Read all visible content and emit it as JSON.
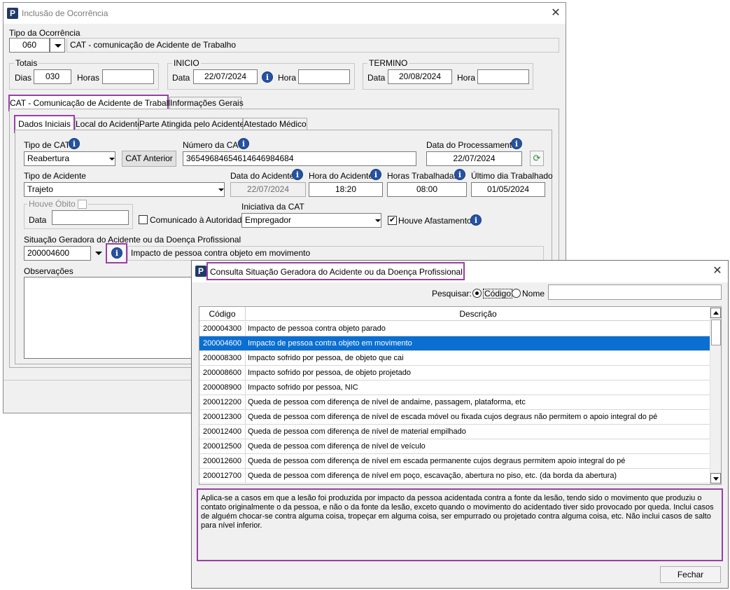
{
  "main_window": {
    "title": "Inclusão de Ocorrência",
    "tipo_ocorrencia": {
      "label": "Tipo da Ocorrência",
      "code": "060",
      "description": "CAT - comunicação de Acidente de Trabalho"
    },
    "totais": {
      "title": "Totais",
      "dias_label": "Dias",
      "dias_value": "030",
      "horas_label": "Horas",
      "horas_value": ""
    },
    "inicio": {
      "title": "INICIO",
      "data_label": "Data",
      "data_value": "22/07/2024",
      "hora_label": "Hora",
      "hora_value": ""
    },
    "termino": {
      "title": "TERMINO",
      "data_label": "Data",
      "data_value": "20/08/2024",
      "hora_label": "Hora",
      "hora_value": ""
    },
    "outer_tabs": [
      "CAT - Comunicação de Acidente de Trabalho",
      "Informações Gerais"
    ],
    "inner_tabs": [
      "Dados Iniciais",
      "Local do Acidente",
      "Parte Atingida pelo Acidente",
      "Atestado Médico"
    ],
    "form": {
      "tipo_cat_label": "Tipo de CAT",
      "tipo_cat_value": "Reabertura",
      "cat_anterior_label": "CAT Anterior",
      "numero_cat_label": "Número da CAT",
      "numero_cat_value": "36549684654614646984684",
      "data_processamento_label": "Data do Processamento",
      "data_processamento_value": "22/07/2024",
      "tipo_acidente_label": "Tipo de Acidente",
      "tipo_acidente_value": "Trajeto",
      "data_acidente_label": "Data do Acidente",
      "data_acidente_value": "22/07/2024",
      "hora_acidente_label": "Hora do Acidente",
      "hora_acidente_value": "18:20",
      "horas_trabalhadas_label": "Horas Trabalhadas",
      "horas_trabalhadas_value": "08:00",
      "ultimo_dia_label": "Último dia Trabalhado",
      "ultimo_dia_value": "01/05/2024",
      "houve_obito_label": "Houve Óbito",
      "obito_data_label": "Data",
      "obito_data_value": "",
      "comunicado_label": "Comunicado à Autoridade",
      "iniciativa_label": "Iniciativa da CAT",
      "iniciativa_value": "Empregador",
      "houve_afastamento_label": "Houve Afastamento",
      "houve_afastamento_checked": true,
      "situacao_label": "Situação Geradora do Acidente ou da Doença Profissional",
      "situacao_code": "200004600",
      "situacao_desc": "Impacto de pessoa contra objeto em movimento",
      "observacoes_label": "Observações"
    }
  },
  "dialog": {
    "title": "Consulta Situação Geradora do Acidente ou da Doença Profissional",
    "search_label": "Pesquisar:",
    "radio_codigo": "Código",
    "radio_nome": "Nome",
    "search_value": "",
    "columns": [
      "Código",
      "Descrição"
    ],
    "rows": [
      {
        "code": "200004300",
        "desc": "Impacto de pessoa contra objeto parado"
      },
      {
        "code": "200004600",
        "desc": "Impacto de pessoa contra objeto em movimento",
        "selected": true
      },
      {
        "code": "200008300",
        "desc": "Impacto sofrido por pessoa, de objeto que cai"
      },
      {
        "code": "200008600",
        "desc": "Impacto sofrido por pessoa, de objeto projetado"
      },
      {
        "code": "200008900",
        "desc": "Impacto sofrido por pessoa, NIC"
      },
      {
        "code": "200012200",
        "desc": "Queda de pessoa com diferença de nível de andaime, passagem, plataforma, etc"
      },
      {
        "code": "200012300",
        "desc": "Queda de pessoa com diferença de nível de escada móvel ou fixada cujos degraus não permitem o apoio integral do pé"
      },
      {
        "code": "200012400",
        "desc": "Queda de pessoa com diferença de nível de material empilhado"
      },
      {
        "code": "200012500",
        "desc": "Queda de pessoa com diferença de nível de veículo"
      },
      {
        "code": "200012600",
        "desc": "Queda de pessoa com diferença de nível em escada permanente cujos degraus permitem apoio integral do pé"
      },
      {
        "code": "200012700",
        "desc": "Queda de pessoa com diferença de nível em poço, escavação, abertura no piso, etc. (da borda da abertura)"
      }
    ],
    "description_text": "Aplica-se a casos em que a lesão foi produzida por impacto da pessoa acidentada contra a fonte da lesão, tendo sido o movimento que produziu o contato originalmente o da pessoa, e não o da fonte da lesão, exceto quando o movimento do acidentado tiver sido provocado por queda. Inclui casos de alguém chocar-se contra alguma coisa, tropeçar em alguma coisa, ser empurrado ou projetado contra alguma coisa, etc. Não inclui casos de salto para nível inferior.",
    "close_button": "Fechar"
  },
  "colors": {
    "highlight": "#9a3fa6",
    "selection": "#0b6fd1",
    "info_icon": "#2553a3"
  }
}
